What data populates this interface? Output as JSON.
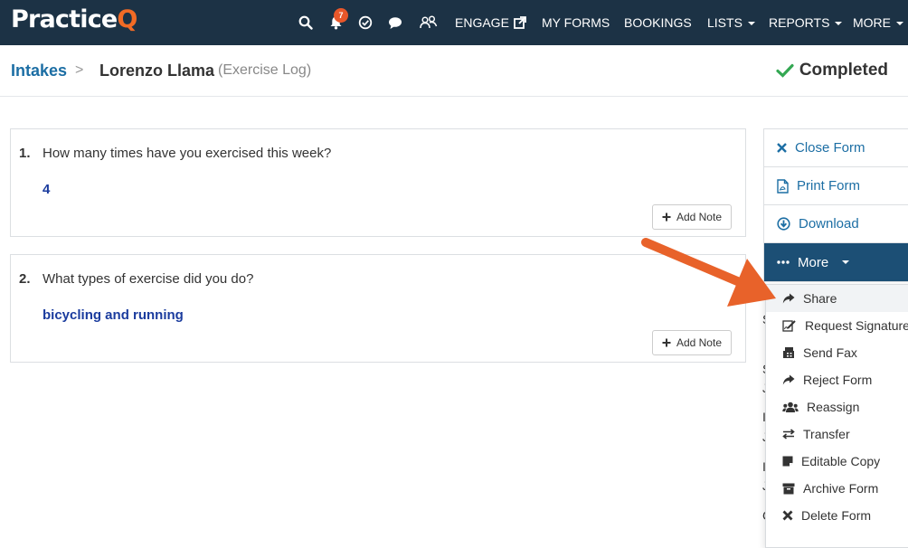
{
  "app": {
    "logo_main": "Practice",
    "logo_q": "Q",
    "notification_count": "7"
  },
  "nav": {
    "items": [
      {
        "label": "ENGAGE",
        "has_external_icon": true
      },
      {
        "label": "MY FORMS"
      },
      {
        "label": "BOOKINGS"
      },
      {
        "label": "LISTS",
        "has_caret": true
      },
      {
        "label": "REPORTS",
        "has_caret": true
      },
      {
        "label": "MORE",
        "has_caret": true
      }
    ],
    "icons": [
      "search-icon",
      "bell-icon",
      "check-circle-icon",
      "chat-icon",
      "users-icon"
    ]
  },
  "breadcrumb": {
    "parent": "Intakes",
    "separator": ">",
    "client_name": "Lorenzo Llama",
    "form_name": "(Exercise Log)"
  },
  "status": {
    "label": "Completed",
    "color": "#34a853"
  },
  "questions": [
    {
      "number": "1.",
      "text": "How many times have you exercised this week?",
      "answer": "4",
      "add_note_label": "Add Note"
    },
    {
      "number": "2.",
      "text": "What types of exercise did you do?",
      "answer": "bicycling and running",
      "add_note_label": "Add Note"
    }
  ],
  "actions": {
    "close_form": "Close Form",
    "print_form": "Print Form",
    "download": "Download",
    "more": "More"
  },
  "more_menu": [
    {
      "label": "Share",
      "icon": "share-icon"
    },
    {
      "label": "Request Signature",
      "icon": "signature-icon"
    },
    {
      "label": "Send Fax",
      "icon": "fax-icon"
    },
    {
      "label": "Reject Form",
      "icon": "reject-icon"
    },
    {
      "label": "Reassign",
      "icon": "users-icon"
    },
    {
      "label": "Transfer",
      "icon": "transfer-icon"
    },
    {
      "label": "Editable Copy",
      "icon": "note-icon"
    },
    {
      "label": "Archive Form",
      "icon": "archive-icon"
    },
    {
      "label": "Delete Form",
      "icon": "delete-icon"
    }
  ],
  "colors": {
    "topbar": "#1c3245",
    "brand_orange": "#f26b25",
    "link_blue": "#1c6ea4",
    "answer_blue": "#1b3c9e",
    "more_button": "#1c4f75",
    "arrow": "#e8622a"
  }
}
